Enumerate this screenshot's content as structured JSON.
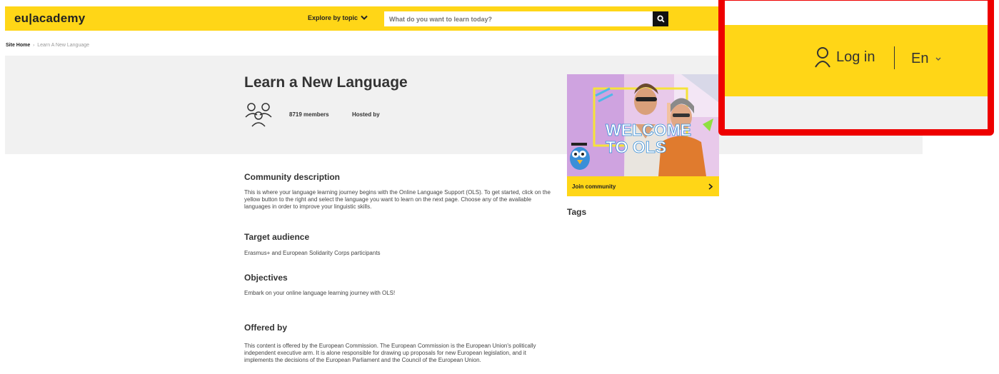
{
  "header": {
    "logo": "eu|academy",
    "explore_label": "Explore by topic",
    "search_placeholder": "What do you want to learn today?"
  },
  "breadcrumb": {
    "home": "Site Home",
    "separator": "›",
    "current": "Learn A New Language"
  },
  "hero": {
    "title": "Learn a New Language",
    "members": "8719 members",
    "hosted_by": "Hosted by"
  },
  "card": {
    "image_text_line1": "WELCOME",
    "image_text_line2": "TO OLS",
    "join_label": "Join community"
  },
  "tags": {
    "heading": "Tags"
  },
  "sections": {
    "description_heading": "Community description",
    "description_text": "This is where your language learning journey begins with the Online Language Support (OLS). To get started, click on the yellow button to the right and select the language you want to learn on the next page. Choose any of the available languages in order to improve your linguistic skills.",
    "audience_heading": "Target audience",
    "audience_text": "Erasmus+ and European Solidarity Corps participants",
    "objectives_heading": "Objectives",
    "objectives_text": "Embark on your online language learning journey with OLS!",
    "offered_heading": "Offered by",
    "offered_text": "This content is offered by the European Commission. The European Commission is the European Union's politically independent executive arm. It is alone responsible for drawing up proposals for new European legislation, and it implements the decisions of the European Parliament and the Council of the European Union."
  },
  "overlay": {
    "login_label": "Log in",
    "language_label": "En"
  },
  "colors": {
    "brand_yellow": "#ffd617",
    "highlight_red": "#ee0000",
    "hero_gray": "#f1f1f1"
  },
  "icons": [
    "chevron-down-icon",
    "search-icon",
    "members-icon",
    "chevron-right-icon",
    "user-icon"
  ]
}
